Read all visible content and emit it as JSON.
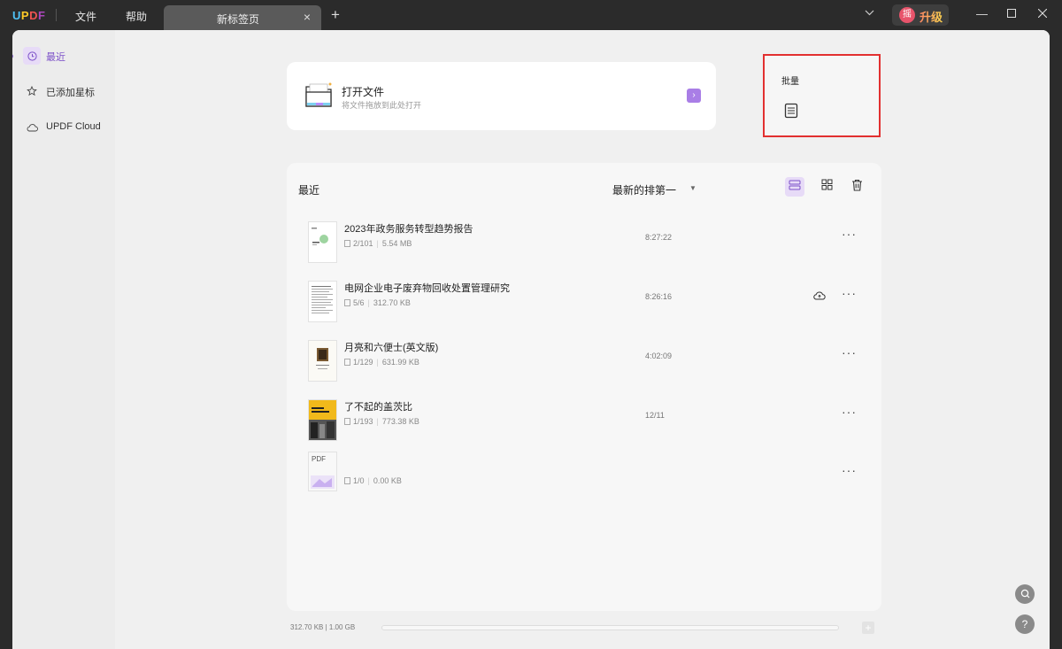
{
  "titlebar": {
    "logo": "UPDF",
    "menu": [
      "文件",
      "帮助"
    ],
    "tab_title": "新标签页",
    "upgrade_avatar": "摇",
    "upgrade_label": "升级"
  },
  "sidebar": {
    "items": [
      {
        "label": "最近",
        "icon": "clock-icon"
      },
      {
        "label": "已添加星标",
        "icon": "star-icon"
      },
      {
        "label": "UPDF Cloud",
        "icon": "cloud-icon"
      }
    ]
  },
  "open_file": {
    "title": "打开文件",
    "subtitle": "将文件拖放到此处打开",
    "arrow": "›"
  },
  "batch": {
    "title": "批量"
  },
  "recent": {
    "title": "最近",
    "sort_label": "最新的排第一",
    "files": [
      {
        "name": "2023年政务服务转型趋势报告",
        "pages": "2/101",
        "size": "5.54 MB",
        "time": "8:27:22",
        "cloud": false
      },
      {
        "name": "电网企业电子废弃物回收处置管理研究",
        "pages": "5/6",
        "size": "312.70 KB",
        "time": "8:26:16",
        "cloud": true
      },
      {
        "name": "月亮和六便士(英文版)",
        "pages": "1/129",
        "size": "631.99 KB",
        "time": "4:02:09",
        "cloud": false
      },
      {
        "name": "了不起的盖茨比",
        "pages": "1/193",
        "size": "773.38 KB",
        "time": "12/11",
        "cloud": false
      },
      {
        "name": "",
        "pages": "1/0",
        "size": "0.00 KB",
        "time": "",
        "cloud": false,
        "thumb_label": "PDF"
      }
    ]
  },
  "footer": {
    "storage": "312.70 KB | 1.00 GB"
  },
  "colors": {
    "accent": "#8e6ad4",
    "highlight_box": "#e23030"
  }
}
